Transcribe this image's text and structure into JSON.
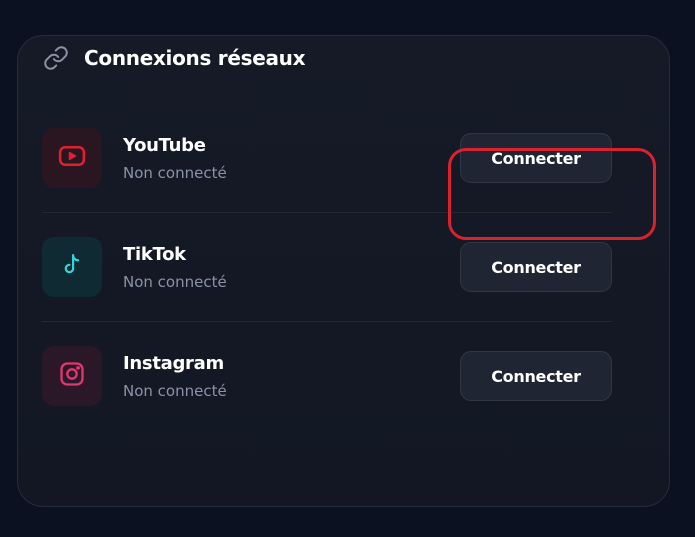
{
  "section": {
    "title": "Connexions réseaux",
    "icon": "link-icon"
  },
  "networks": [
    {
      "name": "YouTube",
      "status": "Non connecté",
      "button_label": "Connecter",
      "icon": "youtube-icon",
      "icon_color": "#e0202c"
    },
    {
      "name": "TikTok",
      "status": "Non connecté",
      "button_label": "Connecter",
      "icon": "tiktok-icon",
      "icon_color": "#2fd6dc"
    },
    {
      "name": "Instagram",
      "status": "Non connecté",
      "button_label": "Connecter",
      "icon": "instagram-icon",
      "icon_color": "#e0386e"
    }
  ],
  "colors": {
    "background": "#0b1120",
    "card": "#151a26",
    "highlight": "#d9222e",
    "muted_text": "#8a93a6"
  }
}
